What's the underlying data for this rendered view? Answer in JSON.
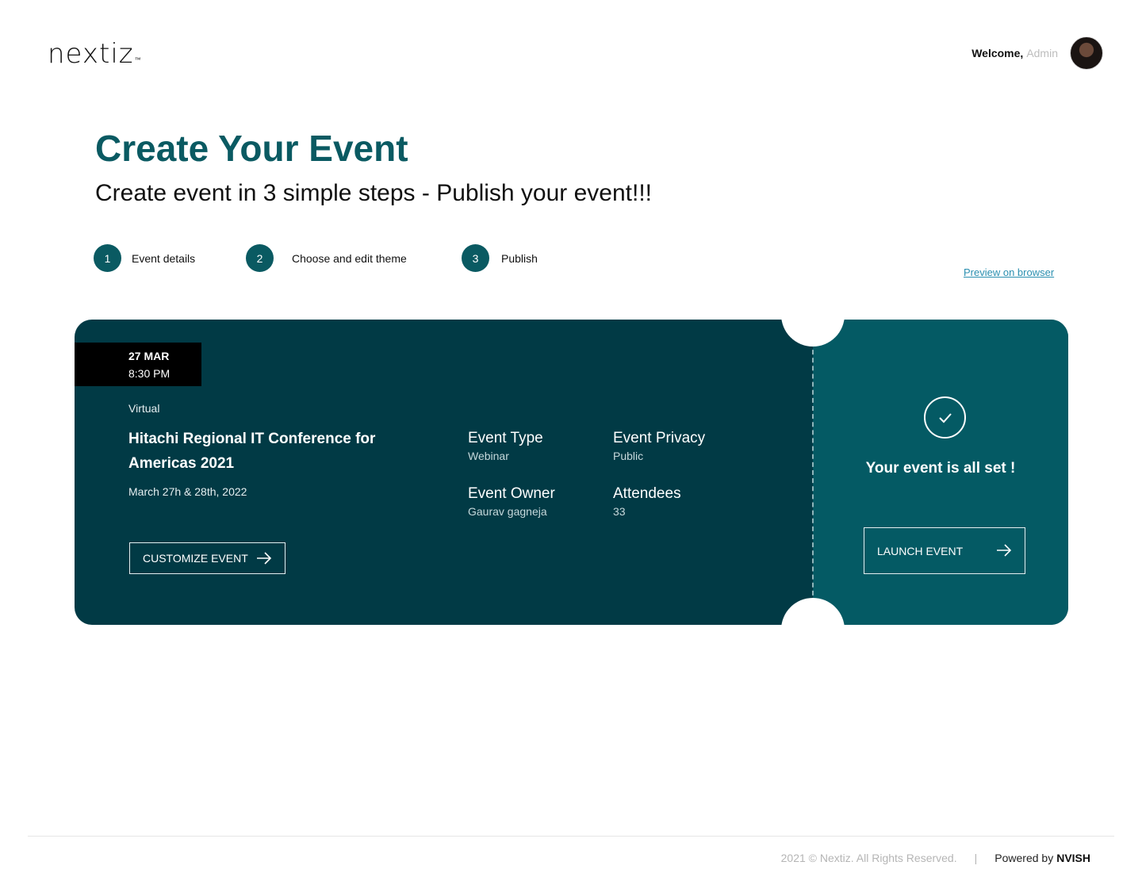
{
  "header": {
    "logo_text": "nextiz",
    "logo_tm": "™",
    "welcome_label": "Welcome,",
    "user_name": "Admin"
  },
  "page": {
    "title": "Create Your Event",
    "subtitle": "Create event in 3 simple steps - Publish your event!!!"
  },
  "steps": [
    {
      "number": "1",
      "label": "Event details"
    },
    {
      "number": "2",
      "label": "Choose and edit theme"
    },
    {
      "number": "3",
      "label": "Publish"
    }
  ],
  "preview_link": "Preview on browser",
  "event": {
    "date": "27 MAR",
    "time": "8:30 PM",
    "mode": "Virtual",
    "name": "Hitachi Regional IT Conference for Americas 2021",
    "dates": "March 27h & 28th, 2022",
    "type_label": "Event Type",
    "type_value": "Webinar",
    "privacy_label": "Event Privacy",
    "privacy_value": "Public",
    "owner_label": "Event Owner",
    "owner_value": "Gaurav gagneja",
    "attendees_label": "Attendees",
    "attendees_value": "33",
    "customize_label": "CUSTOMIZE EVENT"
  },
  "status": {
    "message": "Your event is all set !",
    "launch_label": "LAUNCH EVENT"
  },
  "footer": {
    "copyright": "2021 © Nextiz. All Rights Reserved.",
    "separator": "|",
    "powered_label": "Powered by",
    "powered_brand": "NVISH"
  },
  "colors": {
    "primary": "#0a5a62",
    "card_dark": "#013a45",
    "card_right": "#045a64",
    "link": "#2a8fb0"
  }
}
